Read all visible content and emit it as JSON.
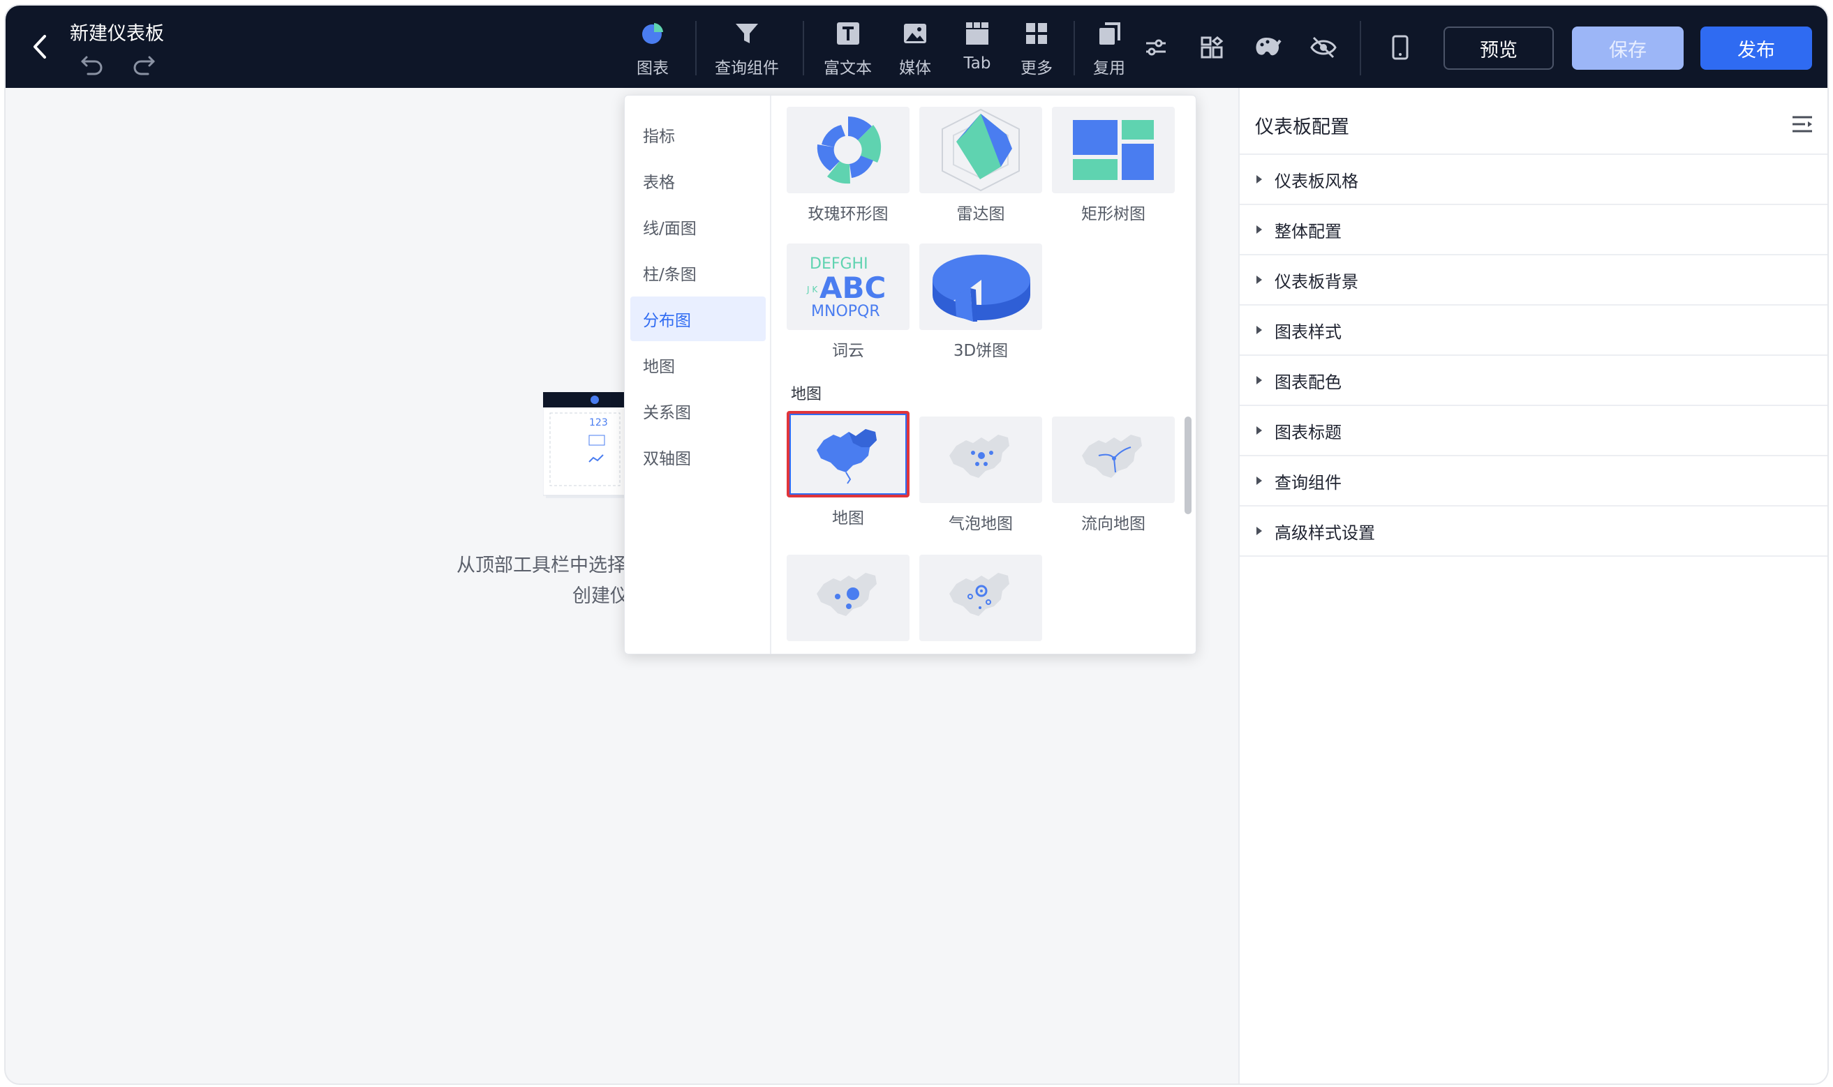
{
  "header": {
    "title": "新建仪表板",
    "tools": [
      {
        "label": "图表",
        "icon": "pie-chart-icon"
      },
      {
        "label": "查询组件",
        "icon": "filter-icon"
      },
      {
        "label": "富文本",
        "icon": "text-icon"
      },
      {
        "label": "媒体",
        "icon": "image-icon"
      },
      {
        "label": "Tab",
        "icon": "tab-icon"
      },
      {
        "label": "更多",
        "icon": "grid-icon"
      },
      {
        "label": "复用",
        "icon": "copy-icon"
      }
    ],
    "preview_label": "预览",
    "save_label": "保存",
    "publish_label": "发布"
  },
  "dropdown": {
    "categories": [
      "指标",
      "表格",
      "线/面图",
      "柱/条图",
      "分布图",
      "地图",
      "关系图",
      "双轴图"
    ],
    "active_category": "分布图",
    "tiles": [
      "玫瑰环形图",
      "雷达图",
      "矩形树图",
      "词云",
      "3D饼图"
    ],
    "section_map_title": "地图",
    "map_tiles": [
      "地图",
      "气泡地图",
      "流向地图"
    ],
    "wordcloud": {
      "line1": "DEFGHI",
      "line2": "ABC",
      "line3": "MNOPQR",
      "side": "J K"
    }
  },
  "canvas": {
    "placeholder_line1": "从顶部工具栏中选择",
    "placeholder_line2": "创建仪",
    "thumb_number": "123"
  },
  "right_panel": {
    "title": "仪表板配置",
    "items": [
      "仪表板风格",
      "整体配置",
      "仪表板背景",
      "图表样式",
      "图表配色",
      "图表标题",
      "查询组件",
      "高级样式设置"
    ]
  },
  "colors": {
    "topbar": "#0e1628",
    "accent": "#2f6bf2",
    "save_disabled": "#9cb6f7",
    "chart_blue": "#4a7df0",
    "chart_green": "#5fd3b0",
    "selected_border": "#e0353b"
  }
}
